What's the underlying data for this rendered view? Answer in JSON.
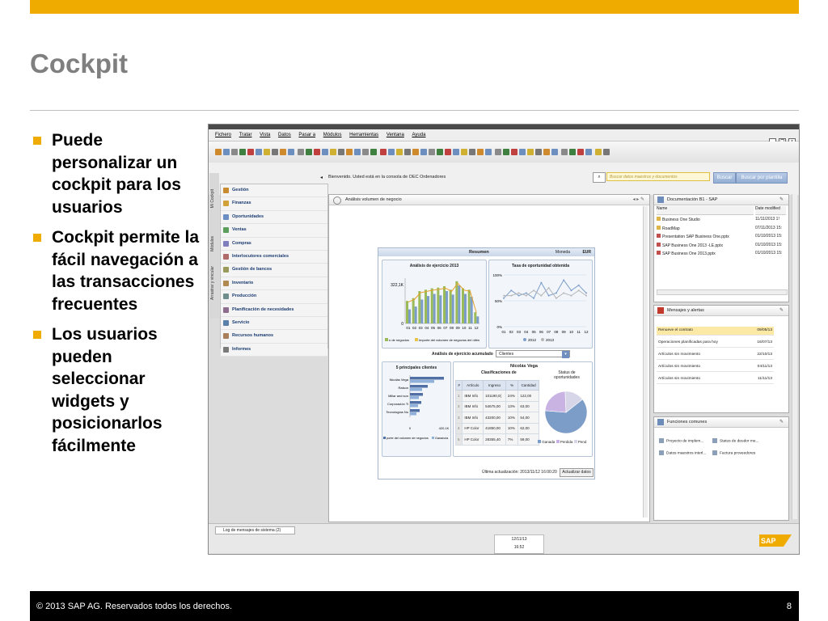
{
  "slide": {
    "title": "Cockpit",
    "bullets": [
      "Puede personalizar un cockpit para los usuarios",
      "Cockpit permite la fácil navegación a las transacciones frecuentes",
      "Los usuarios pueden seleccionar widgets y posicionarlos fácilmente"
    ],
    "footer_copy": "©  2013 SAP AG. Reservados todos los derechos.",
    "page_number": "8",
    "accent_color": "#f0ab00"
  },
  "app": {
    "menu": [
      "Fichero",
      "Tratar",
      "Vista",
      "Datos",
      "Pasar a",
      "Módulos",
      "Herramientas",
      "Ventana",
      "Ayuda"
    ],
    "welcome": "Bienvenido. Usted está en la consola de OEC Ordenadores",
    "search_placeholder": "Buscar datos maestros y documentos",
    "search_button": "Buscar",
    "search_template_button": "Buscar por plantilla",
    "vertical_tabs": [
      "Mi Cockpit",
      "Módulos",
      "Arrastrar y vincular"
    ],
    "modules": [
      "Gestión",
      "Finanzas",
      "Oportunidades",
      "Ventas",
      "Compras",
      "Interlocutores comerciales",
      "Gestión de bancos",
      "Inventario",
      "Producción",
      "Planificación de necesidades",
      "Servicio",
      "Recursos humanos",
      "Informes"
    ],
    "main_widget_title": "Análisis volumen de negocio",
    "resumen": {
      "title": "Resumen",
      "moneda_label": "Moneda",
      "moneda_value": "EUR",
      "analisis_title": "Análisis de ejercicio 2013",
      "analisis_ymax": "322,1K",
      "analisis_y0": "0",
      "analisis_legend": [
        "n de negocios",
        "Importe del volumen de negocios del últim"
      ],
      "tasa_title": "Tasa de oportunidad obtenida",
      "tasa_ticks": [
        "100%",
        "50%",
        "0%"
      ],
      "tasa_legend": [
        "2012",
        "2013"
      ],
      "acum_label": "Análisis de ejercicio acumulado",
      "acum_value": "Clientes",
      "top5_title": "5 principales clientes",
      "top5_x": [
        "0",
        "420,1K"
      ],
      "top5_legend": [
        "porte del volumen de negocios",
        "Ganancia"
      ],
      "clasif_title": "Clasificaciones de",
      "clasif_name": "Nicolás Vega",
      "clasif_headers": [
        "#",
        "Artículo",
        "Ingreso",
        "%",
        "Cantidad"
      ],
      "clasif_rows": [
        [
          "1",
          "IBM Info",
          "101190,0(",
          "24%",
          "122,00"
        ],
        [
          "2",
          "IBM Info",
          "54675,00",
          "13%",
          "63,00"
        ],
        [
          "3",
          "IBM Info",
          "43200,00",
          "10%",
          "54,00"
        ],
        [
          "4",
          "HP Color",
          "41850,00",
          "10%",
          "62,00"
        ],
        [
          "5",
          "HP Color",
          "28355,40",
          "7%",
          "59,00"
        ]
      ],
      "status_title": "Status de oportunidades",
      "status_legend": [
        "Ganada",
        "Perdida",
        "Pend"
      ],
      "last_update": "Última actualización: 2013/11/12 16:00:20",
      "update_button": "Actualizar datos"
    },
    "docs": {
      "title": "Documentación B1 - SAP",
      "col_name": "Name",
      "col_date": "Date modified",
      "rows": [
        {
          "name": "Business One Studio",
          "date": "11/11/2013 1!"
        },
        {
          "name": "RoadMap",
          "date": "07/11/2013 15:"
        },
        {
          "name": "Presentation SAP Business One.pptx",
          "date": "01/10/2013 15:"
        },
        {
          "name": "SAP Business One 2013 -LE.pptx",
          "date": "01/10/2013 15:"
        },
        {
          "name": "SAP Business One 2013.pptx",
          "date": "01/10/2013 15:"
        }
      ]
    },
    "alerts": {
      "title": "Mensajes y alertas",
      "rows": [
        {
          "label": "Renueve el contrato",
          "date": "09/05/13"
        },
        {
          "label": "Operaciones planificadas para hoy",
          "date": "16/07/13"
        },
        {
          "label": "Artículos sin movimiento",
          "date": "22/10/13"
        },
        {
          "label": "Artículos sin movimiento",
          "date": "04/11/13"
        },
        {
          "label": "Artículos sin movimiento",
          "date": "11/11/13"
        }
      ]
    },
    "funciones": {
      "title": "Funciones comunes",
      "items": [
        "Proyecto de implem...",
        "Status de deudor me...",
        "Datos maestros interl...",
        "Factura proveedores"
      ]
    },
    "status": {
      "log_tab": "Log de mensajes de sistema (2)",
      "date": "12/11/13",
      "time": "16:52"
    }
  },
  "chart_data": [
    {
      "type": "bar",
      "title": "Análisis de ejercicio 2013",
      "categories": [
        "01",
        "02",
        "03",
        "04",
        "05",
        "06",
        "07",
        "08",
        "09",
        "10",
        "11",
        "12"
      ],
      "series": [
        {
          "name": "n de negocios",
          "values": [
            160,
            180,
            230,
            240,
            250,
            255,
            265,
            240,
            300,
            250,
            240,
            80
          ]
        },
        {
          "name": "Importe del volumen de negocios del últim",
          "values": [
            100,
            120,
            170,
            195,
            210,
            200,
            230,
            205,
            270,
            210,
            190,
            50
          ]
        }
      ],
      "ylim": [
        0,
        322.1
      ]
    },
    {
      "type": "line",
      "title": "Tasa de oportunidad obtenida",
      "categories": [
        "01",
        "02",
        "03",
        "04",
        "05",
        "06",
        "07",
        "08",
        "09",
        "10",
        "11",
        "12"
      ],
      "series": [
        {
          "name": "2012",
          "values": [
            55,
            70,
            60,
            65,
            55,
            85,
            60,
            65,
            90,
            70,
            80,
            65
          ]
        },
        {
          "name": "2013",
          "values": [
            60,
            60,
            65,
            60,
            70,
            60,
            75,
            55,
            65,
            60,
            70,
            60
          ]
        }
      ],
      "ylim": [
        0,
        100
      ]
    },
    {
      "type": "bar",
      "title": "5 principales clientes",
      "categories": [
        "Nicolás Vega",
        "Raison",
        "Millar and son",
        "Corporación Ti",
        "Tecnologías Nu"
      ],
      "series": [
        {
          "name": "porte del volumen de negocios",
          "values": [
            420.1,
            220,
            160,
            140,
            120
          ]
        },
        {
          "name": "Ganancia",
          "values": [
            300,
            150,
            110,
            100,
            80
          ]
        }
      ],
      "xlim": [
        0,
        420.1
      ]
    },
    {
      "type": "pie",
      "title": "Status de oportunidades",
      "categories": [
        "Ganada",
        "Perdida",
        "Pend"
      ],
      "values": [
        62,
        23,
        15
      ]
    }
  ]
}
